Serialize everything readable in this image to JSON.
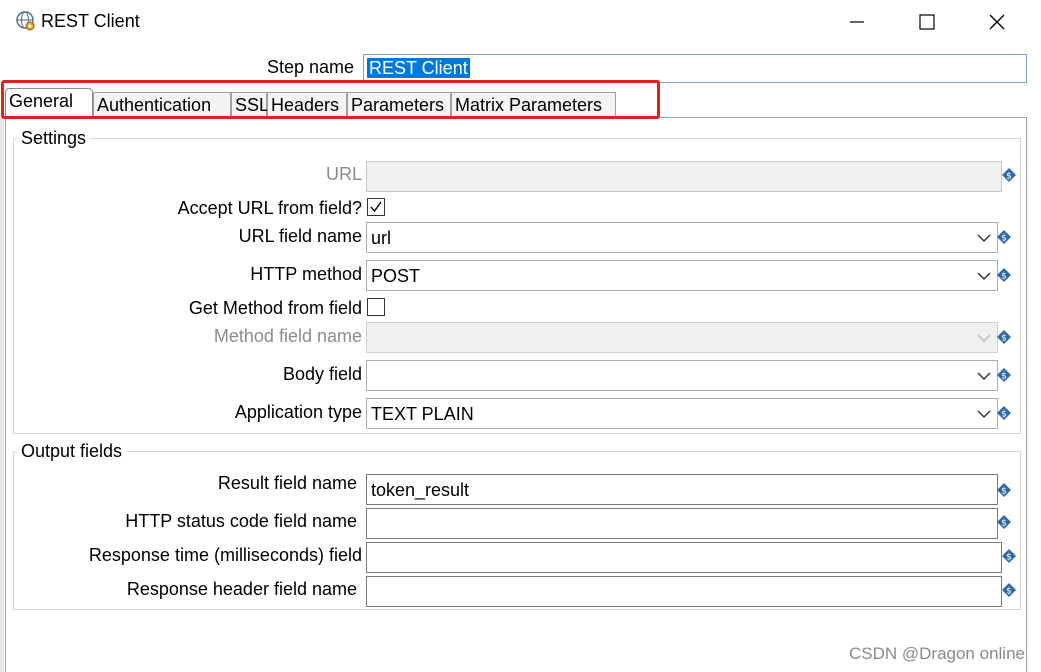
{
  "window": {
    "title": "REST Client",
    "icon": "globe-gear-icon"
  },
  "step_name": {
    "label": "Step name",
    "value": "REST Client"
  },
  "tabs": [
    {
      "label": "General",
      "active": true
    },
    {
      "label": "Authentication",
      "active": false
    },
    {
      "label": "SSL",
      "active": false
    },
    {
      "label": "Headers",
      "active": false
    },
    {
      "label": "Parameters",
      "active": false
    },
    {
      "label": "Matrix Parameters",
      "active": false
    }
  ],
  "settings": {
    "title": "Settings",
    "url_label": "URL",
    "url_value": "",
    "accept_url_label": "Accept URL from field?",
    "accept_url_checked": true,
    "url_field_label": "URL field name",
    "url_field_value": "url",
    "http_method_label": "HTTP method",
    "http_method_value": "POST",
    "get_method_label": "Get Method from field",
    "get_method_checked": false,
    "method_field_label": "Method field name",
    "method_field_value": "",
    "body_field_label": "Body field",
    "body_field_value": "",
    "app_type_label": "Application type",
    "app_type_value": "TEXT PLAIN"
  },
  "output": {
    "title": "Output fields",
    "result_label": "Result field name",
    "result_value": "token_result",
    "status_label": "HTTP status code field name",
    "status_value": "",
    "response_time_label": "Response time (milliseconds) field",
    "response_time_value": "",
    "response_header_label": "Response header field name",
    "response_header_value": ""
  },
  "watermark": "CSDN @Dragon online",
  "colors": {
    "highlight_border": "#e02020",
    "selection": "#0078d7",
    "variable_icon": "#2f6aa8"
  }
}
